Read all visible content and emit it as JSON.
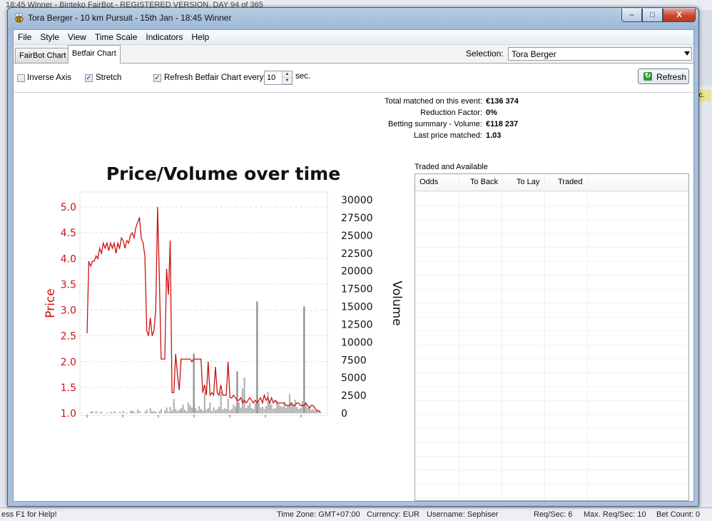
{
  "background": {
    "title": "18:45 Winner - Binteko FairBot - REGISTERED VERSION. DAY 94 of 365",
    "badge": "ec.",
    "status": {
      "help": "ess F1 for Help!",
      "timezone": "Time Zone: GMT+07:00",
      "currency": "Currency: EUR",
      "username": "Username: Sephiser",
      "req_sec": "Req/Sec: 6",
      "max_req_sec": "Max. Req/Sec: 10",
      "bet_count": "Bet Count: 0"
    }
  },
  "window": {
    "title": "Tora Berger - 10 km Pursuit - 15th Jan - 18:45 Winner",
    "caption": {
      "minimize": "–",
      "maximize": "□",
      "close": "X"
    }
  },
  "menu": [
    "File",
    "Style",
    "View",
    "Time Scale",
    "Indicators",
    "Help"
  ],
  "tabs": [
    {
      "label": "FairBot Chart",
      "active": false
    },
    {
      "label": "Betfair Chart",
      "active": true
    }
  ],
  "selection": {
    "label": "Selection:",
    "value": "Tora Berger"
  },
  "options": {
    "inverse_axis": {
      "label": "Inverse Axis",
      "checked": false
    },
    "stretch": {
      "label": "Stretch",
      "checked": true
    },
    "refresh_every": {
      "label": "Refresh Betfair Chart every",
      "checked": true,
      "value": "10",
      "unit": "sec."
    },
    "refresh_button": "Refresh"
  },
  "summary": [
    {
      "label": "Total matched on this event:",
      "value": "€136 374"
    },
    {
      "label": "Reduction Factor:",
      "value": "0%"
    },
    {
      "label": "Betting summary - Volume:",
      "value": "€118 237"
    },
    {
      "label": "Last price matched:",
      "value": "1.03"
    }
  ],
  "traded_available": {
    "label": "Traded and Available",
    "columns": [
      "Odds",
      "To Back",
      "To Lay",
      "Traded"
    ],
    "rows": []
  },
  "colors": {
    "price": "#cc1111",
    "volume": "#999999",
    "accent_check": "#213a68"
  },
  "chart_data": {
    "type": "line",
    "title": "Price/Volume over time",
    "ylabel": "Price",
    "y2label": "Volume",
    "ylim": [
      1.0,
      5.0
    ],
    "y2lim": [
      0,
      30000
    ],
    "yticks": [
      "5.0",
      "4.5",
      "4.0",
      "3.5",
      "3.0",
      "2.5",
      "2.0",
      "1.5",
      "1.0"
    ],
    "y2ticks": [
      "30000",
      "27500",
      "25000",
      "22500",
      "20000",
      "17500",
      "15000",
      "12500",
      "10000",
      "7500",
      "5000",
      "2500",
      "0"
    ],
    "grid": true,
    "series": [
      {
        "values": [
          2.55,
          3.95,
          3.85,
          3.95,
          3.95,
          4.05,
          4.0,
          4.2,
          4.1,
          4.3,
          4.2,
          4.3,
          4.15,
          4.3,
          4.2,
          4.3,
          4.1,
          4.3,
          4.2,
          4.4,
          4.35,
          4.2,
          4.35,
          4.3,
          4.45,
          4.5,
          4.4,
          4.6,
          4.7,
          4.8,
          4.4,
          4.3,
          4.05,
          2.6,
          2.5,
          2.85,
          2.5,
          2.6,
          3.0,
          5.0,
          3.6,
          2.05,
          2.05,
          2.05,
          3.8,
          3.3,
          4.35,
          1.4,
          1.4,
          2.15,
          1.75,
          1.45,
          2.05,
          2.05,
          2.05,
          2.05,
          2.05,
          2.05,
          2.0,
          2.05,
          2.05,
          2.05,
          2.05,
          2.05,
          1.4,
          1.55,
          1.35,
          2.0,
          1.35,
          1.4,
          1.35,
          1.9,
          1.4,
          1.35,
          1.55,
          1.35,
          1.35,
          1.35,
          2.0,
          1.3,
          1.3,
          1.35,
          1.3,
          1.25,
          1.25,
          1.3,
          1.2,
          1.25,
          1.2,
          1.25,
          1.3,
          1.25,
          1.2,
          1.25,
          1.2,
          1.25,
          1.3,
          1.2,
          1.35,
          1.25,
          1.3,
          1.2,
          1.3,
          1.2,
          1.25,
          1.2,
          1.2,
          1.2,
          1.2,
          1.2,
          1.15,
          1.15,
          1.15,
          1.2,
          1.15,
          1.15,
          1.2,
          1.2,
          1.15,
          1.15,
          1.15,
          1.2,
          1.15,
          1.1,
          1.15,
          1.15,
          1.1,
          1.05,
          1.05,
          1.03
        ]
      },
      {
        "name": "Volume",
        "values": [
          0,
          0,
          200,
          300,
          0,
          300,
          0,
          100,
          200,
          0,
          0,
          100,
          0,
          200,
          0,
          300,
          0,
          0,
          200,
          0,
          300,
          0,
          100,
          0,
          300,
          400,
          200,
          0,
          500,
          300,
          0,
          0,
          200,
          500,
          0,
          700,
          200,
          300,
          200,
          0,
          300,
          600,
          0,
          400,
          800,
          200,
          900,
          400,
          2000,
          600,
          300,
          500,
          700,
          1200,
          500,
          300,
          1500,
          1100,
          800,
          8400,
          700,
          400,
          1000,
          600,
          400,
          3000,
          500,
          700,
          1500,
          300,
          800,
          400,
          600,
          900,
          3000,
          500,
          700,
          600,
          2000,
          400,
          600,
          1200,
          900,
          5900,
          1500,
          800,
          3500,
          5000,
          700,
          1100,
          1500,
          700,
          600,
          1400,
          15700,
          1600,
          800,
          900,
          600,
          1000,
          3000,
          1600,
          1200,
          600,
          700,
          1800,
          1300,
          1000,
          900,
          1600,
          800,
          1000,
          2700,
          1500,
          1100,
          1900,
          900,
          600,
          700,
          1700,
          15000,
          1400,
          800,
          900,
          500,
          600,
          400,
          500,
          300,
          200
        ]
      }
    ]
  }
}
